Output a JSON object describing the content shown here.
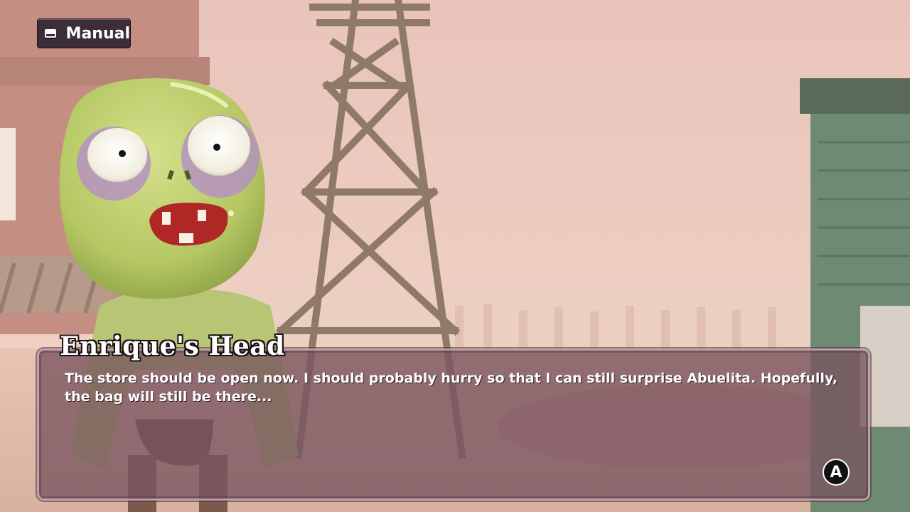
{
  "ui": {
    "manual_label": "Manual",
    "manual_icon": "keyboard-key-icon"
  },
  "dialog": {
    "speaker": "Enrique's Head",
    "text": "The store should be open now. I should probably hurry so that I can still surprise Abuelita. Hopefully, the bag will still be there...",
    "advance_button": "A"
  },
  "colors": {
    "sky": "#eccac0",
    "dialog_bg": "#785460",
    "zombie_skin": "#b8cf6a",
    "tower_wood": "#9b8776",
    "building_green": "#6f8a72"
  }
}
